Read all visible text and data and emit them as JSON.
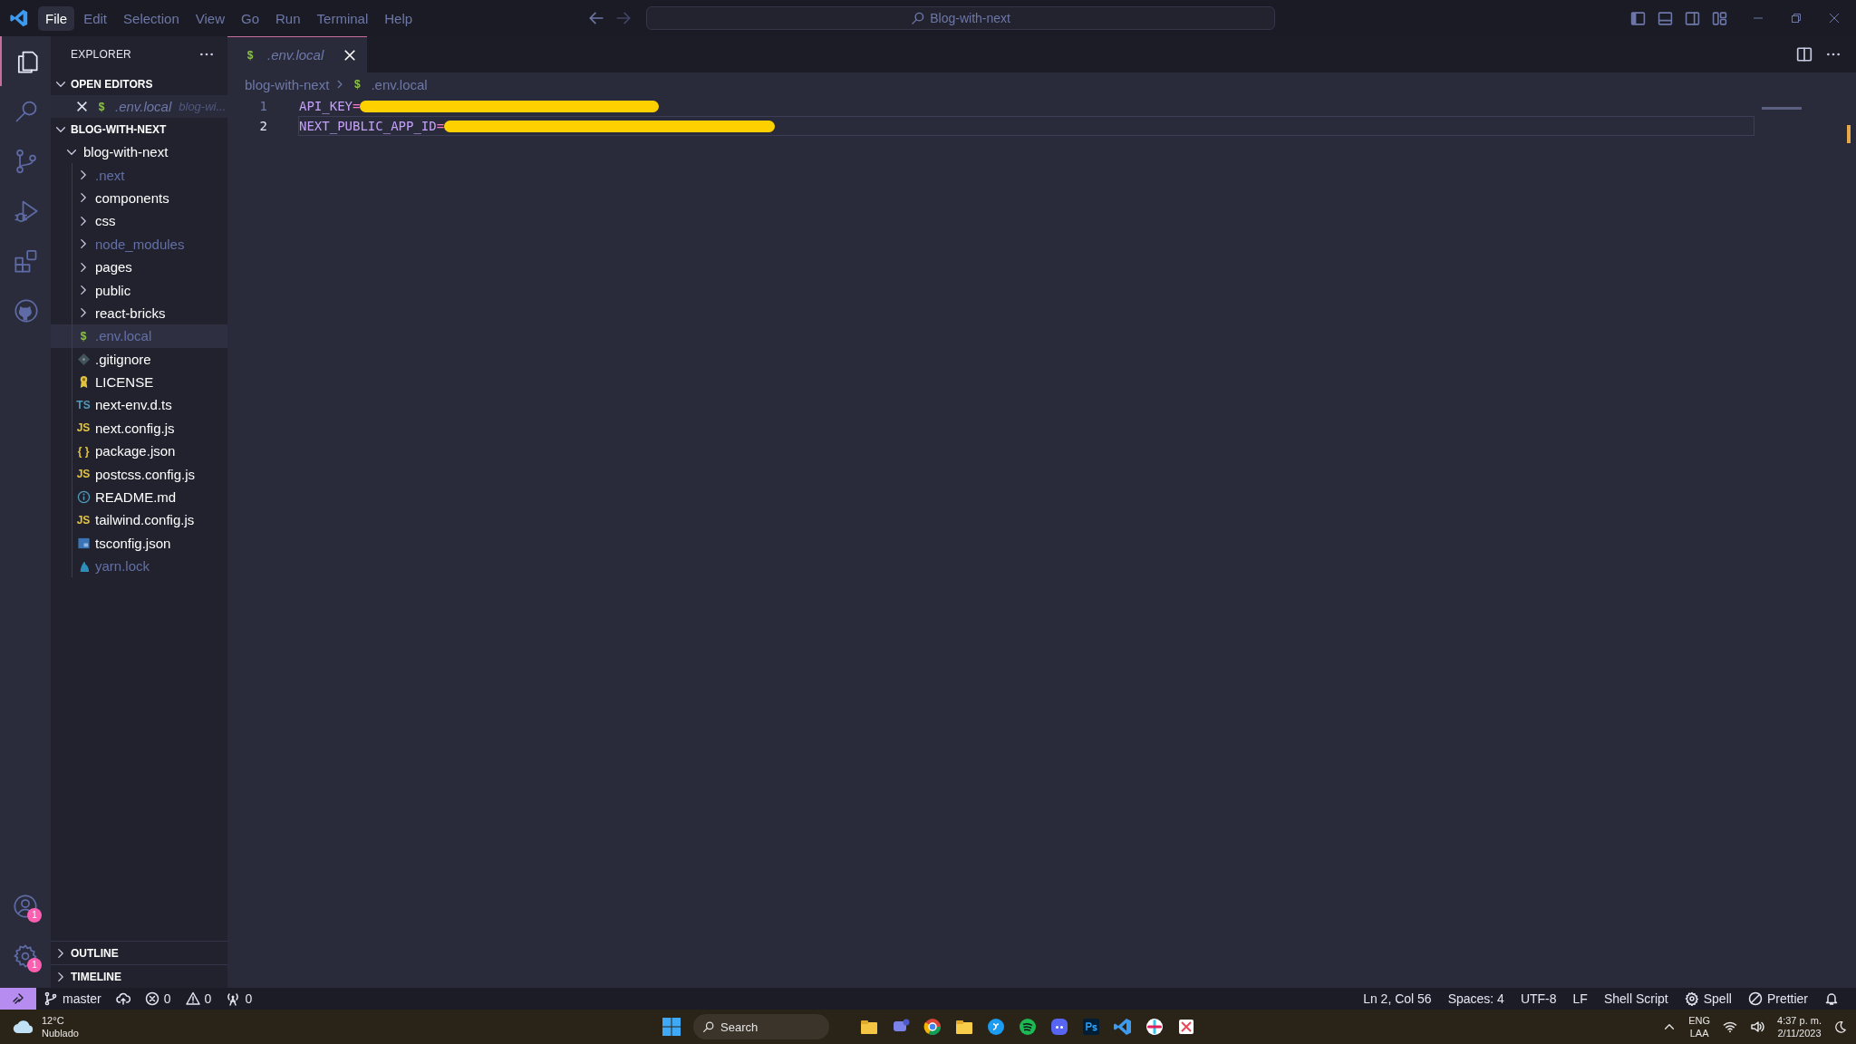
{
  "menu": [
    {
      "label": "File",
      "selected": true
    },
    {
      "label": "Edit",
      "selected": false
    },
    {
      "label": "Selection",
      "selected": false
    },
    {
      "label": "View",
      "selected": false
    },
    {
      "label": "Go",
      "selected": false
    },
    {
      "label": "Run",
      "selected": false
    },
    {
      "label": "Terminal",
      "selected": false
    },
    {
      "label": "Help",
      "selected": false
    }
  ],
  "command_center": {
    "text": "Blog-with-next"
  },
  "activity_bar": {
    "items": [
      {
        "kind": "explorer",
        "selected": true
      },
      {
        "kind": "search",
        "selected": false
      },
      {
        "kind": "source-control",
        "selected": false
      },
      {
        "kind": "run-debug",
        "selected": false
      },
      {
        "kind": "extensions",
        "selected": false
      },
      {
        "kind": "github",
        "selected": false
      }
    ],
    "bottom": [
      {
        "kind": "accounts",
        "badge": "1"
      },
      {
        "kind": "settings",
        "badge": "1"
      }
    ]
  },
  "sidebar": {
    "title": "EXPLORER",
    "open_editors": {
      "title": "OPEN EDITORS",
      "expanded": true,
      "items": [
        {
          "name": ".env.local",
          "description": "blog-wi...",
          "kind": "shell",
          "glyph": "$",
          "preview": true
        }
      ]
    },
    "project": {
      "title": "BLOG-WITH-NEXT",
      "expanded": true,
      "tree": [
        {
          "name": "blog-with-next",
          "kind": "folder",
          "expanded": true,
          "dimmed": false,
          "selected": false,
          "children": [
            {
              "name": ".next",
              "kind": "folder",
              "expanded": false,
              "dimmed": true,
              "selected": false
            },
            {
              "name": "components",
              "kind": "folder",
              "expanded": false,
              "dimmed": false,
              "selected": false
            },
            {
              "name": "css",
              "kind": "folder",
              "expanded": false,
              "dimmed": false,
              "selected": false
            },
            {
              "name": "node_modules",
              "kind": "folder",
              "expanded": false,
              "dimmed": true,
              "selected": false
            },
            {
              "name": "pages",
              "kind": "folder",
              "expanded": false,
              "dimmed": false,
              "selected": false
            },
            {
              "name": "public",
              "kind": "folder",
              "expanded": false,
              "dimmed": false,
              "selected": false
            },
            {
              "name": "react-bricks",
              "kind": "folder",
              "expanded": false,
              "dimmed": false,
              "selected": false
            },
            {
              "name": ".env.local",
              "kind": "shell",
              "glyph": "$",
              "dimmed": true,
              "selected": true
            },
            {
              "name": ".gitignore",
              "kind": "git",
              "dimmed": false,
              "selected": false
            },
            {
              "name": "LICENSE",
              "kind": "license",
              "dimmed": false,
              "selected": false
            },
            {
              "name": "next-env.d.ts",
              "kind": "ts",
              "glyph": "TS",
              "dimmed": false,
              "selected": false
            },
            {
              "name": "next.config.js",
              "kind": "js",
              "glyph": "JS",
              "dimmed": false,
              "selected": false
            },
            {
              "name": "package.json",
              "kind": "json",
              "glyph": "{ }",
              "dimmed": false,
              "selected": false
            },
            {
              "name": "postcss.config.js",
              "kind": "js",
              "glyph": "JS",
              "dimmed": false,
              "selected": false
            },
            {
              "name": "README.md",
              "kind": "readme",
              "dimmed": false,
              "selected": false
            },
            {
              "name": "tailwind.config.js",
              "kind": "js",
              "glyph": "JS",
              "dimmed": false,
              "selected": false
            },
            {
              "name": "tsconfig.json",
              "kind": "tsconfig",
              "dimmed": false,
              "selected": false
            },
            {
              "name": "yarn.lock",
              "kind": "yarn",
              "dimmed": true,
              "selected": false
            }
          ]
        }
      ]
    },
    "bottom_sections": [
      {
        "title": "OUTLINE",
        "expanded": false
      },
      {
        "title": "TIMELINE",
        "expanded": false
      }
    ]
  },
  "tabs": [
    {
      "label": ".env.local",
      "glyph": "$",
      "kind": "shell",
      "selected": true,
      "preview": true
    }
  ],
  "breadcrumb": {
    "folder": "blog-with-next",
    "file": ".env.local",
    "glyph": "$"
  },
  "editor": {
    "lines": [
      {
        "number": "1",
        "key": "API_KEY",
        "operator": "=",
        "redacted": true,
        "current": false
      },
      {
        "number": "2",
        "key": "NEXT_PUBLIC_APP_ID",
        "operator": "=",
        "redacted": true,
        "current": true
      }
    ]
  },
  "status_bar": {
    "left": [
      {
        "kind": "remote"
      },
      {
        "kind": "branch",
        "text": "master"
      },
      {
        "kind": "sync"
      },
      {
        "kind": "errors",
        "text": "0"
      },
      {
        "kind": "warnings",
        "text": "0"
      },
      {
        "kind": "ports",
        "text": "0"
      }
    ],
    "right": [
      {
        "kind": "text",
        "text": "Ln 2, Col 56"
      },
      {
        "kind": "text",
        "text": "Spaces: 4"
      },
      {
        "kind": "text",
        "text": "UTF-8"
      },
      {
        "kind": "text",
        "text": "LF"
      },
      {
        "kind": "text",
        "text": "Shell Script"
      },
      {
        "kind": "spell",
        "text": "Spell"
      },
      {
        "kind": "prettier",
        "text": "Prettier"
      },
      {
        "kind": "bell"
      }
    ]
  },
  "taskbar": {
    "weather": {
      "temperature": "12°C",
      "condition": "Nublado"
    },
    "search": {
      "placeholder": "Search"
    },
    "tray": {
      "language": "ENG",
      "layout": "LAA",
      "time": "4:37 p. m.",
      "date": "2/11/2023"
    }
  }
}
